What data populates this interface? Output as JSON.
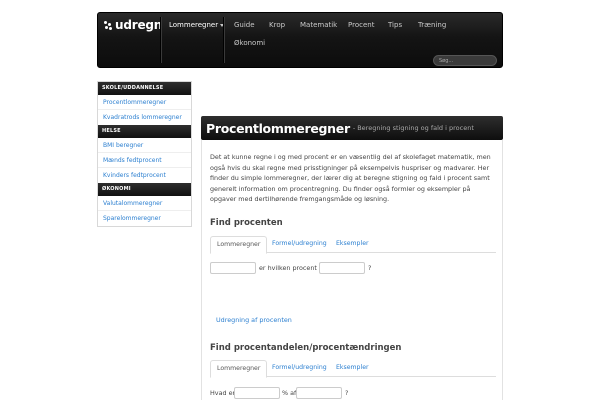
{
  "brand": {
    "name": "udregn"
  },
  "nav": {
    "items": [
      {
        "label": "Lommeregner"
      },
      {
        "label": "Guide"
      },
      {
        "label": "Krop"
      },
      {
        "label": "Matematik"
      },
      {
        "label": "Procent"
      },
      {
        "label": "Tips"
      },
      {
        "label": "Træning"
      },
      {
        "label": "Økonomi"
      }
    ],
    "search_placeholder": "Søg..."
  },
  "sidebar": {
    "sections": [
      {
        "heading": "SKOLE/UDDANNELSE",
        "items": [
          "Procentlommeregner",
          "Kvadratrods lommeregner"
        ]
      },
      {
        "heading": "HELSE",
        "items": [
          "BMI beregner",
          "Mænds fedtprocent",
          "Kvinders fedtprocent"
        ]
      },
      {
        "heading": "ØKONOMI",
        "items": [
          "Valutalommeregner",
          "Sparelommeregner"
        ]
      }
    ]
  },
  "page": {
    "title": "Procentlommeregner",
    "subtitle": "- Beregning stigning og fald i procent",
    "intro": "Det at kunne regne i og med procent er en væsentlig del af skolefaget matematik, men også hvis du skal regne med prisstigninger på eksempelvis huspriser og madvarer. Her finder du simple lommeregner, der lærer dig at beregne stigning og fald i procent samt generelt information om procentregning. Du finder også formler og eksempler på opgaver med dertilhørende fremgangsmåde og løsning."
  },
  "section1": {
    "title": "Find procenten",
    "tabs": [
      "Lommeregner",
      "Formel/udregning",
      "Eksempler"
    ],
    "middle_text": "er hvilken procent af",
    "end_text": "?",
    "link": "Udregning af procenten"
  },
  "section2": {
    "title": "Find procentandelen/procentændringen",
    "tabs": [
      "Lommeregner",
      "Formel/udregning",
      "Eksempler"
    ],
    "prefix": "Hvad er",
    "middle_text": "% af",
    "end_text": "?"
  }
}
